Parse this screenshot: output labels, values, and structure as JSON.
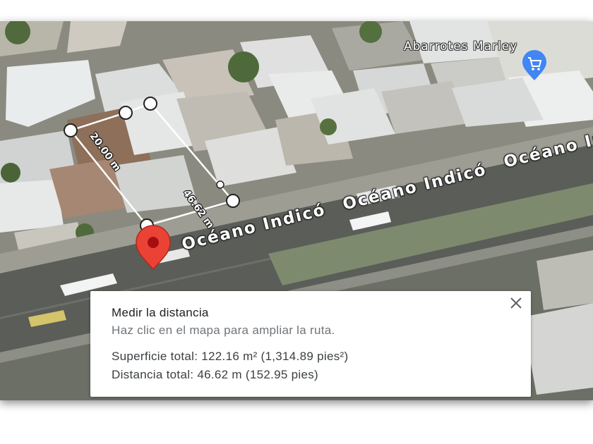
{
  "map": {
    "street_labels": [
      "Océano Indicó",
      "Océano Indicó",
      "Océano Indicó"
    ],
    "poi": {
      "name": "Abarrotes Marley",
      "icon": "shopping-cart-icon",
      "color": "#4285f4"
    },
    "measurement": {
      "segment_short": "20.00 m",
      "segment_long": "46.62 m",
      "vertex_count": 6
    },
    "pin": {
      "icon": "map-pin-icon",
      "color": "#ea4335"
    }
  },
  "measure_panel": {
    "title": "Medir la distancia",
    "hint": "Haz clic en el mapa para ampliar la ruta.",
    "total_area": "Superficie total: 122.16 m² (1,314.89 pies²)",
    "total_distance": "Distancia total: 46.62 m (152.95 pies)",
    "close_icon": "close-icon"
  }
}
